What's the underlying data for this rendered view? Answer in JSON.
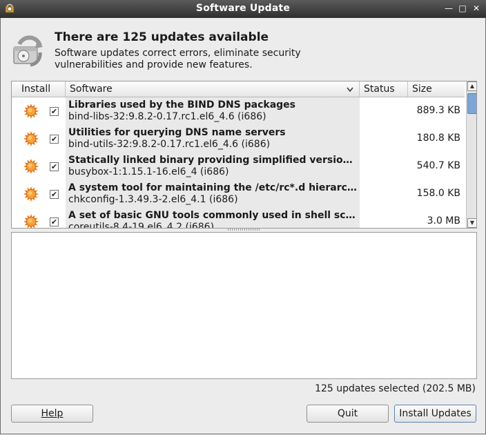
{
  "window": {
    "title": "Software Update"
  },
  "header": {
    "title": "There are 125 updates available",
    "description": "Software updates correct errors, eliminate security vulnerabilities and provide new features."
  },
  "columns": {
    "install": "Install",
    "software": "Software",
    "status": "Status",
    "size": "Size"
  },
  "packages": [
    {
      "name": "Libraries used by the BIND DNS packages",
      "package": "bind-libs-32:9.8.2-0.17.rc1.el6_4.6 (i686)",
      "status": "",
      "size": "889.3 KB",
      "checked": true
    },
    {
      "name": "Utilities for querying DNS name servers",
      "package": "bind-utils-32:9.8.2-0.17.rc1.el6_4.6 (i686)",
      "status": "",
      "size": "180.8 KB",
      "checked": true
    },
    {
      "name": "Statically linked binary providing simplified versions of many common UNIX utilities",
      "package": "busybox-1:1.15.1-16.el6_4 (i686)",
      "status": "",
      "size": "540.7 KB",
      "checked": true
    },
    {
      "name": "A system tool for maintaining the /etc/rc*.d hierarchy",
      "package": "chkconfig-1.3.49.3-2.el6_4.1 (i686)",
      "status": "",
      "size": "158.0 KB",
      "checked": true
    },
    {
      "name": "A set of basic GNU tools commonly used in shell scripts",
      "package": "coreutils-8.4-19.el6_4.2 (i686)",
      "status": "",
      "size": "3.0 MB",
      "checked": true
    }
  ],
  "summary": "125 updates selected (202.5 MB)",
  "buttons": {
    "help": "Help",
    "quit": "Quit",
    "install": "Install Updates"
  },
  "icons": {
    "update_type": "security-update-star-icon",
    "header": "software-update-icon"
  }
}
